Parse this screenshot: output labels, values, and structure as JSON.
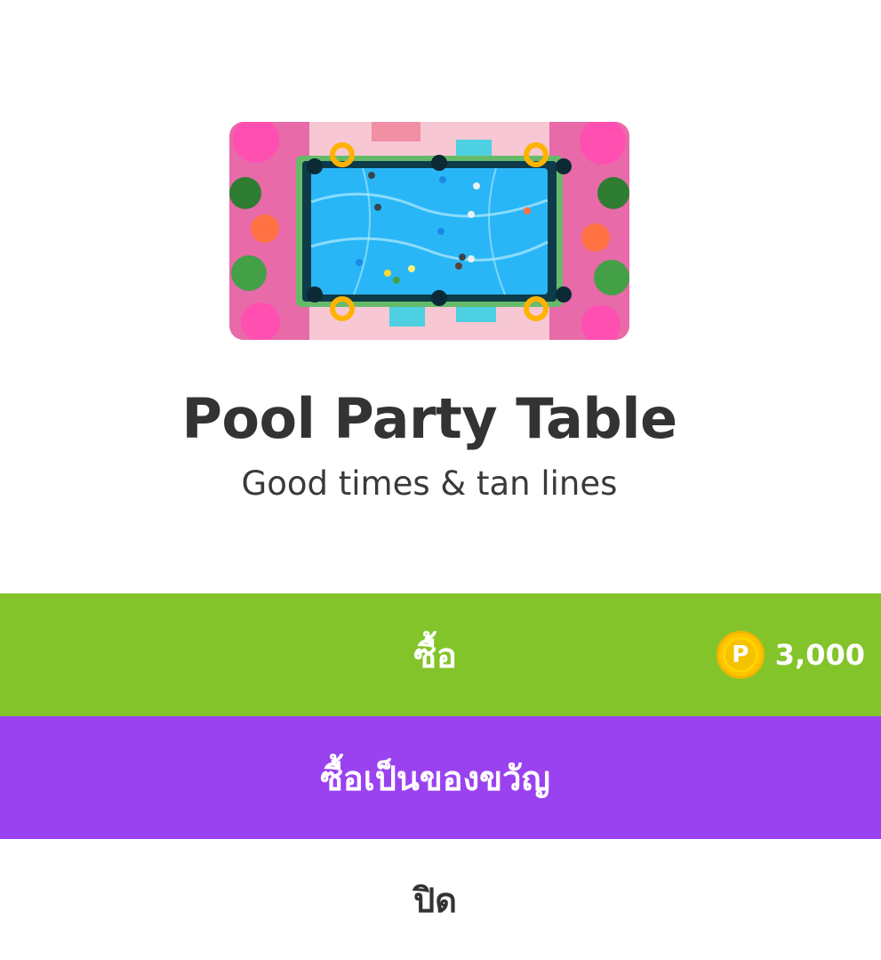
{
  "item": {
    "title": "Pool Party Table",
    "subtitle": "Good times & tan lines",
    "image_icon": "pool-table-preview-icon"
  },
  "buy": {
    "label": "ซื้อ",
    "price": "3,000",
    "coin_symbol": "P",
    "color": "#83c42a"
  },
  "gift": {
    "label": "ซื้อเป็นของขวัญ",
    "color": "#9b42f0"
  },
  "close": {
    "label": "ปิด"
  }
}
